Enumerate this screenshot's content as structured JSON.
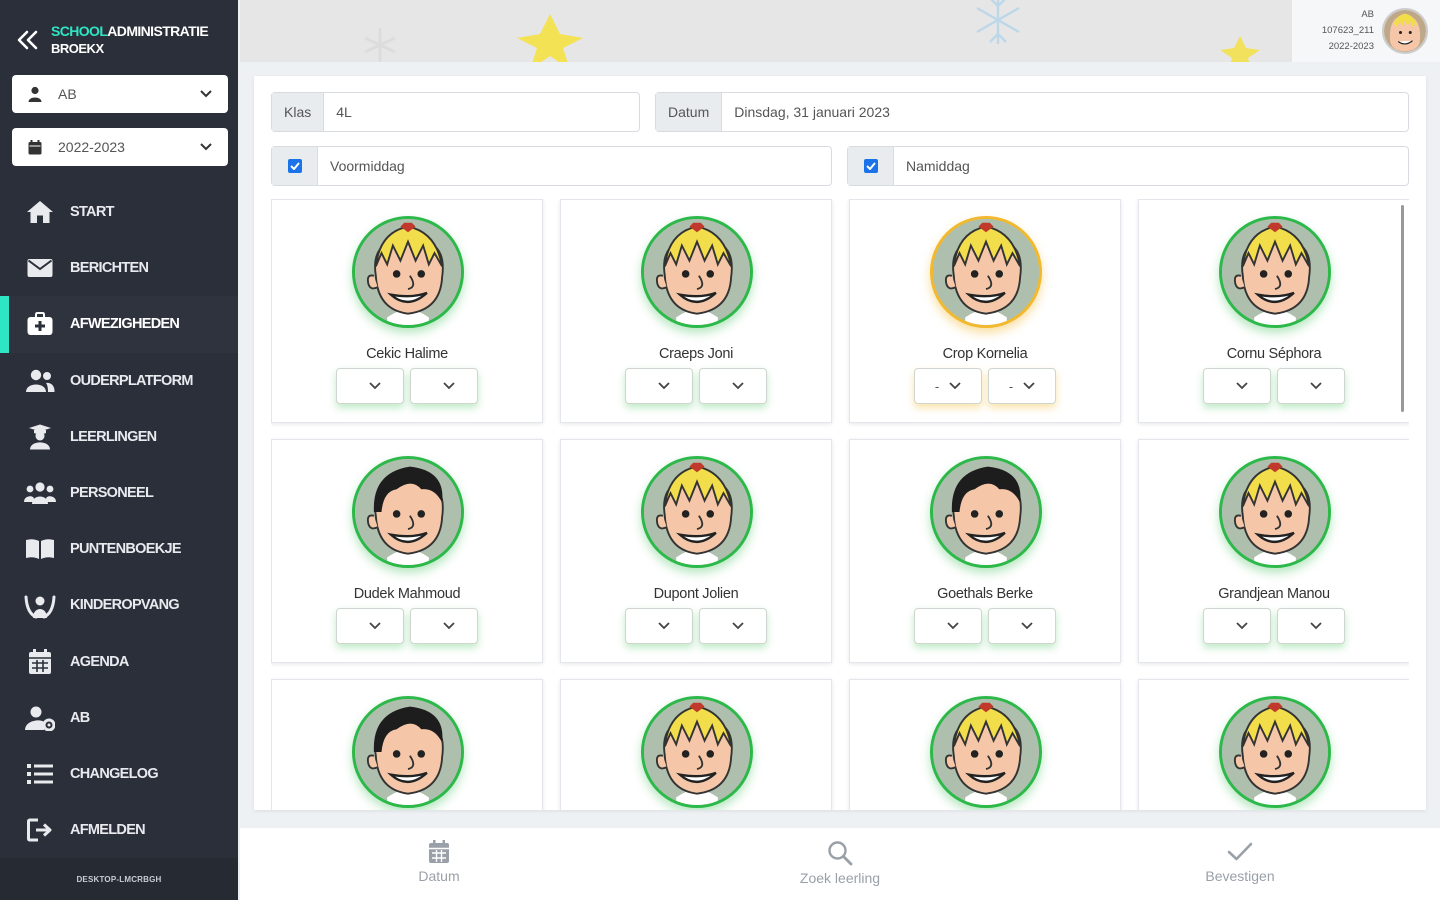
{
  "brand": {
    "part1": "SCHOOL",
    "part2": "ADMINISTRATIE",
    "school": "BROEKX"
  },
  "sidebar": {
    "user_select": "AB",
    "year_select": "2022-2023",
    "items": [
      {
        "label": "START",
        "icon": "home-icon"
      },
      {
        "label": "BERICHTEN",
        "icon": "envelope-icon"
      },
      {
        "label": "AFWEZIGHEDEN",
        "icon": "medical-bag-icon",
        "active": true
      },
      {
        "label": "OUDERPLATFORM",
        "icon": "users-icon"
      },
      {
        "label": "LEERLINGEN",
        "icon": "student-icon"
      },
      {
        "label": "PERSONEEL",
        "icon": "staff-icon"
      },
      {
        "label": "PUNTENBOEKJE",
        "icon": "book-icon"
      },
      {
        "label": "KINDEROPVANG",
        "icon": "childcare-icon"
      },
      {
        "label": "AGENDA",
        "icon": "calendar-icon"
      },
      {
        "label": "AB",
        "icon": "user-cog-icon"
      },
      {
        "label": "CHANGELOG",
        "icon": "list-icon"
      },
      {
        "label": "AFMELDEN",
        "icon": "logout-icon"
      }
    ],
    "footer": "DESKTOP-LMCRBGH"
  },
  "header": {
    "user": "AB",
    "code": "107623_211",
    "year": "2022-2023"
  },
  "filters": {
    "klas_label": "Klas",
    "klas_value": "4L",
    "datum_label": "Datum",
    "datum_value": "Dinsdag, 31 januari 2023",
    "voormiddag_label": "Voormiddag",
    "namiddag_label": "Namiddag"
  },
  "students": [
    {
      "name": "Cekic Halime",
      "status": "ok",
      "hair": "blond",
      "am": "",
      "pm": ""
    },
    {
      "name": "Craeps Joni",
      "status": "ok",
      "hair": "blond",
      "am": "",
      "pm": ""
    },
    {
      "name": "Crop Kornelia",
      "status": "warn",
      "hair": "blond",
      "am": "-",
      "pm": "-"
    },
    {
      "name": "Cornu Séphora",
      "status": "ok",
      "hair": "blond",
      "am": "",
      "pm": ""
    },
    {
      "name": "Dudek Mahmoud",
      "status": "ok",
      "hair": "dark",
      "am": "",
      "pm": ""
    },
    {
      "name": "Dupont Jolien",
      "status": "ok",
      "hair": "blond",
      "am": "",
      "pm": ""
    },
    {
      "name": "Goethals Berke",
      "status": "ok",
      "hair": "dark",
      "am": "",
      "pm": ""
    },
    {
      "name": "Grandjean Manou",
      "status": "ok",
      "hair": "blond",
      "am": "",
      "pm": ""
    },
    {
      "name": "",
      "status": "ok",
      "hair": "dark",
      "am": "",
      "pm": ""
    },
    {
      "name": "",
      "status": "ok",
      "hair": "blond",
      "am": "",
      "pm": ""
    },
    {
      "name": "",
      "status": "ok",
      "hair": "blond",
      "am": "",
      "pm": ""
    },
    {
      "name": "",
      "status": "ok",
      "hair": "blond",
      "am": "",
      "pm": ""
    }
  ],
  "bottom_bar": [
    {
      "label": "Datum",
      "icon": "calendar-icon"
    },
    {
      "label": "Zoek leerling",
      "icon": "search-icon"
    },
    {
      "label": "Bevestigen",
      "icon": "check-icon"
    }
  ],
  "colors": {
    "sidebar": "#2b2f3a",
    "accent": "#2ee6c4",
    "ok": "#2db84a",
    "warn": "#f2b82e",
    "checkbox": "#1a73e8"
  }
}
